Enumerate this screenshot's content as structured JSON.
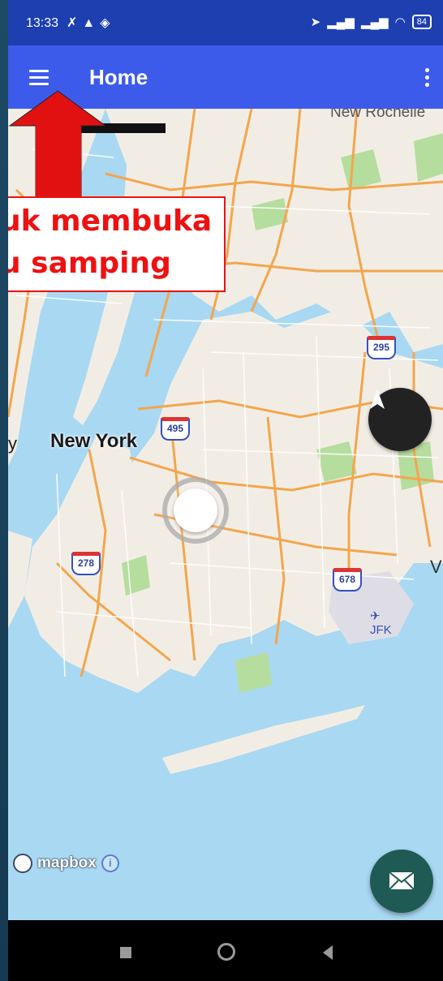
{
  "status_bar": {
    "time": "13:33",
    "left_icons": [
      "mute-icon",
      "navigation-icon",
      "location-icon"
    ],
    "right_icons": [
      "location-arrow-icon",
      "signal-icon",
      "signal-icon",
      "wifi-icon"
    ],
    "battery": "84"
  },
  "app_bar": {
    "title": "Home",
    "menu_icon": "hamburger-menu-icon",
    "overflow_icon": "more-vert-icon",
    "color": "#3d5bea"
  },
  "map": {
    "labels": {
      "new_york": "New York",
      "new_rochelle": "New Rochelle",
      "jfk": "JFK",
      "partial_left": "y",
      "partial_right": "V"
    },
    "shields": [
      "295",
      "495",
      "278",
      "678"
    ],
    "attribution": "mapbox",
    "info_icon": "i",
    "colors": {
      "water": "#a9d8f2",
      "land": "#f2ede4",
      "roads": "#f3a64d",
      "park": "#b5dd9e"
    }
  },
  "controls": {
    "compass_icon": "north-arrow-icon",
    "my_location_icon": "location-arrow-icon",
    "fab_icon": "mail-icon",
    "fab_color": "#1f5a55"
  },
  "annotation": {
    "line1": "uk membuka",
    "line2": "u samping",
    "color": "#e11111"
  },
  "nav_bar": {
    "icons": [
      "recents-square-icon",
      "home-circle-icon",
      "back-triangle-icon"
    ]
  }
}
